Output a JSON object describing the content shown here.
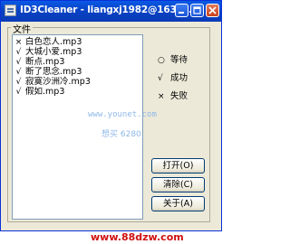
{
  "window": {
    "title": "ID3Cleaner - liangxj1982@163.c...",
    "minimize_label": "_",
    "maximize_label": "□",
    "close_label": "×"
  },
  "file_group": {
    "label": "文件",
    "items": [
      {
        "status": "×",
        "name": "白色恋人.mp3"
      },
      {
        "status": "√",
        "name": "大城小爱.mp3"
      },
      {
        "status": "√",
        "name": "断点.mp3"
      },
      {
        "status": "√",
        "name": "断了思念.mp3"
      },
      {
        "status": "√",
        "name": "寂寞沙洲冷.mp3"
      },
      {
        "status": "√",
        "name": "假如.mp3"
      }
    ]
  },
  "legend": [
    {
      "symbol": "○",
      "label": "等待"
    },
    {
      "symbol": "√",
      "label": "成功"
    },
    {
      "symbol": "×",
      "label": "失败"
    }
  ],
  "buttons": {
    "open": "打开(O)",
    "clear": "清除(C)",
    "about": "关于(A)"
  },
  "watermarks": {
    "site": "www.younet.com",
    "text": "想买 6280",
    "footer": "www.88dzw.com"
  },
  "colors": {
    "titlebar": "#0a5ae6",
    "window_bg": "#ece9d8",
    "footer_watermark": "#d01010"
  }
}
